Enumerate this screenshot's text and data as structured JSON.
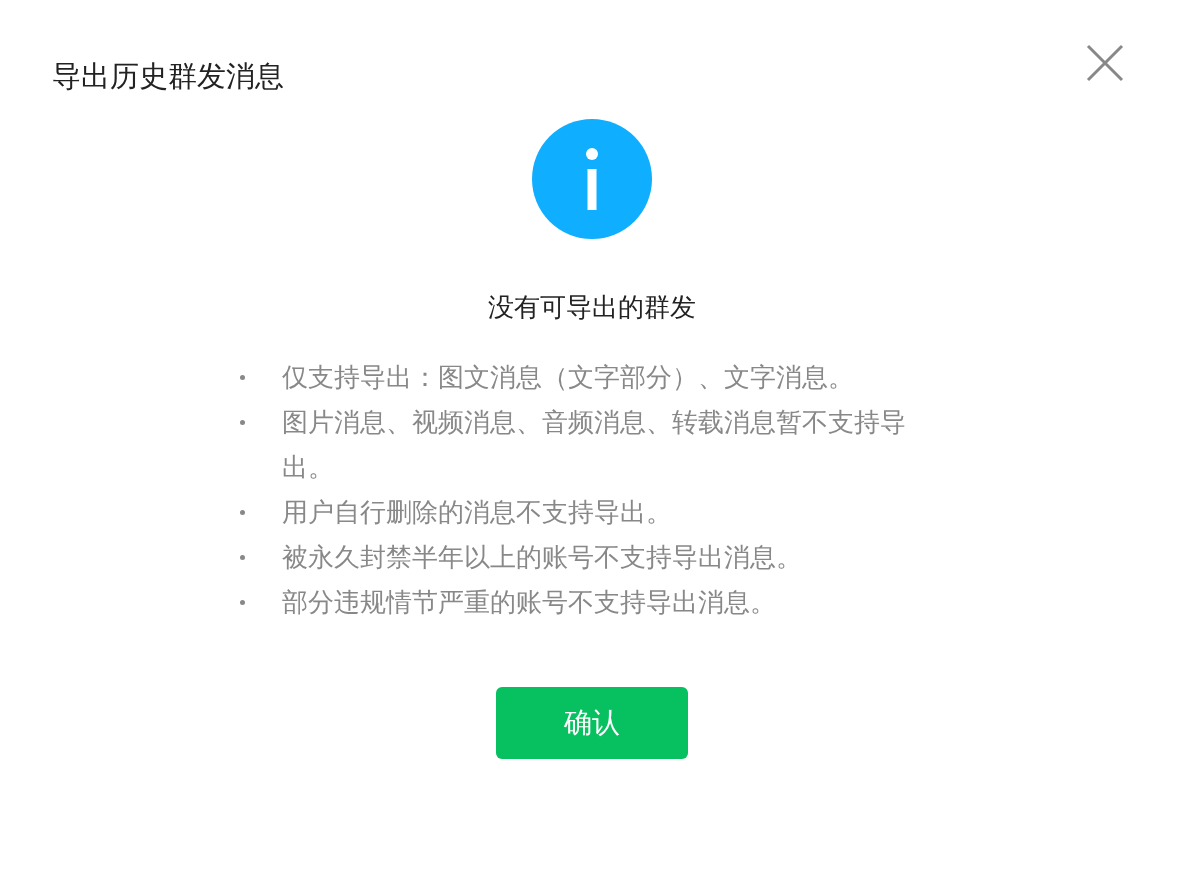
{
  "dialog": {
    "title": "导出历史群发消息",
    "heading": "没有可导出的群发",
    "notes": [
      "仅支持导出：图文消息（文字部分）、文字消息。",
      "图片消息、视频消息、音频消息、转载消息暂不支持导出。",
      "用户自行删除的消息不支持导出。",
      "被永久封禁半年以上的账号不支持导出消息。",
      "部分违规情节严重的账号不支持导出消息。"
    ],
    "buttons": [
      "确认"
    ]
  }
}
